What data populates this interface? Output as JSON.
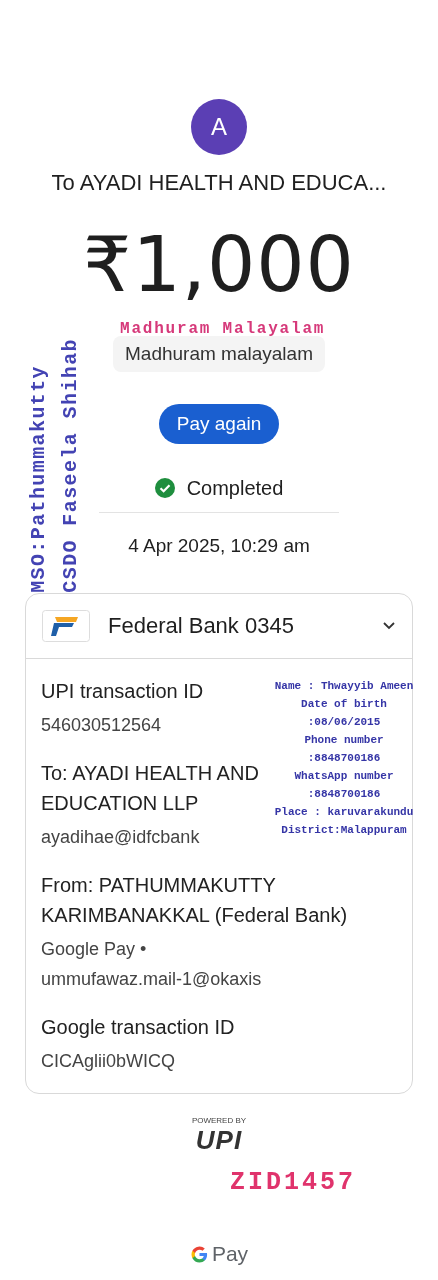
{
  "payee": {
    "avatar_letter": "A",
    "title": "To AYADI HEALTH AND EDUCA..."
  },
  "amount": "₹1,000",
  "note": "Madhuram malayalam",
  "pay_again_button": "Pay again",
  "status": {
    "kind": "completed",
    "label": "Completed"
  },
  "date": "4 Apr 2025, 10:29 am",
  "account_card": {
    "bank": "Federal Bank 0345",
    "expanded": false,
    "details": [
      {
        "label": "UPI transaction ID",
        "value": "546030512564"
      },
      {
        "label": "To: AYADI HEALTH AND EDUCATION LLP",
        "value": "ayadihae@idfcbank"
      },
      {
        "label": "From: PATHUMMAKUTTY KARIMBANAKKAL (Federal Bank)",
        "value": "Google Pay • ummufawaz.mail-1@okaxis"
      },
      {
        "label": "Google transaction ID",
        "value": "CICAglii0bWICQ"
      }
    ]
  },
  "footer": {
    "powered_by": "POWERED BY",
    "upi": "UPI",
    "brand": "Pay"
  },
  "stamps": {
    "note_stamp": "Madhuram Malayalam",
    "vertical": [
      "MSO:Pathummakutty",
      "CSDO Faseela Shihab"
    ],
    "info_lines": [
      "Name : Thwayyib Ameen",
      "Date of birth",
      ":08/06/2015",
      "Phone number",
      ":8848700186",
      "WhatsApp number",
      ":8848700186",
      "Place : karuvarakundu",
      "District:Malappuram"
    ],
    "id_stamp": "ZID1457"
  }
}
